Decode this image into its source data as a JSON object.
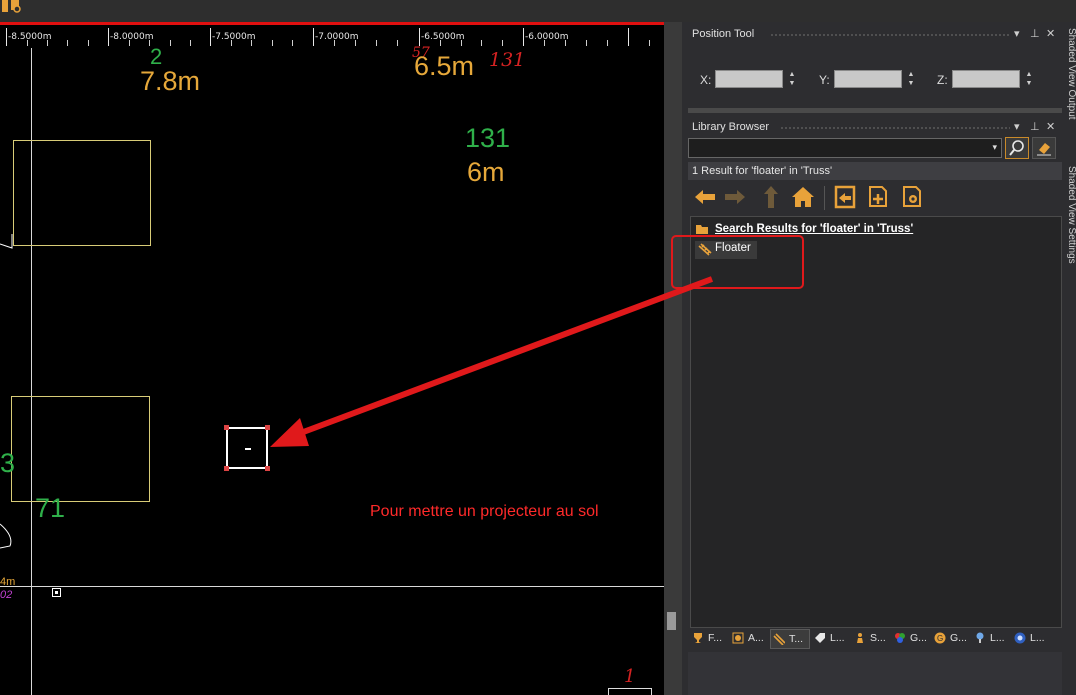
{
  "ruler": {
    "labels": [
      "-8.5000m",
      "-8.0000m",
      "-7.5000m",
      "-7.0000m",
      "-6.5000m",
      "-6.0000m"
    ]
  },
  "canvas": {
    "labels": {
      "top_num_a": "2",
      "top_dist_a": "7.8m",
      "top_num_b": "57",
      "top_dist_b": "6.5m",
      "top_id_b": "131",
      "mid_num": "131",
      "mid_dist": "6m",
      "left_num": "3",
      "left_num2": "71",
      "left_small_dist": "4m",
      "left_small_id": "02",
      "bottom_id": "1"
    },
    "fixture_symbol": "-",
    "note": "Pour mettre un projecteur au sol"
  },
  "position_tool": {
    "title": "Position Tool",
    "x_label": "X:",
    "y_label": "Y:",
    "z_label": "Z:",
    "x_value": "",
    "y_value": "",
    "z_value": ""
  },
  "library_browser": {
    "title": "Library Browser",
    "search_value": "",
    "result_text": "1 Result for 'floater' in 'Truss'",
    "tree_root": "Search Results for 'floater' in 'Truss'",
    "tree_child": "Floater"
  },
  "side_panels": {
    "shaded_output": "Shaded View Output",
    "shaded_settings": "Shaded View Settings"
  },
  "bottom_tabs": [
    {
      "label": "F...",
      "icon": "trophy-icon"
    },
    {
      "label": "A...",
      "icon": "fixture-icon"
    },
    {
      "label": "T...",
      "icon": "truss-icon"
    },
    {
      "label": "L...",
      "icon": "label-icon"
    },
    {
      "label": "S...",
      "icon": "figure-icon"
    },
    {
      "label": "G...",
      "icon": "color-icon"
    },
    {
      "label": "G...",
      "icon": "gobo-icon"
    },
    {
      "label": "L...",
      "icon": "lamp-icon"
    },
    {
      "label": "L...",
      "icon": "lens-icon"
    }
  ],
  "colors": {
    "accent_red": "#e0191b",
    "label_green": "#2fb04a",
    "label_orange": "#e6a83a",
    "icon_orange": "#e8a23a"
  }
}
